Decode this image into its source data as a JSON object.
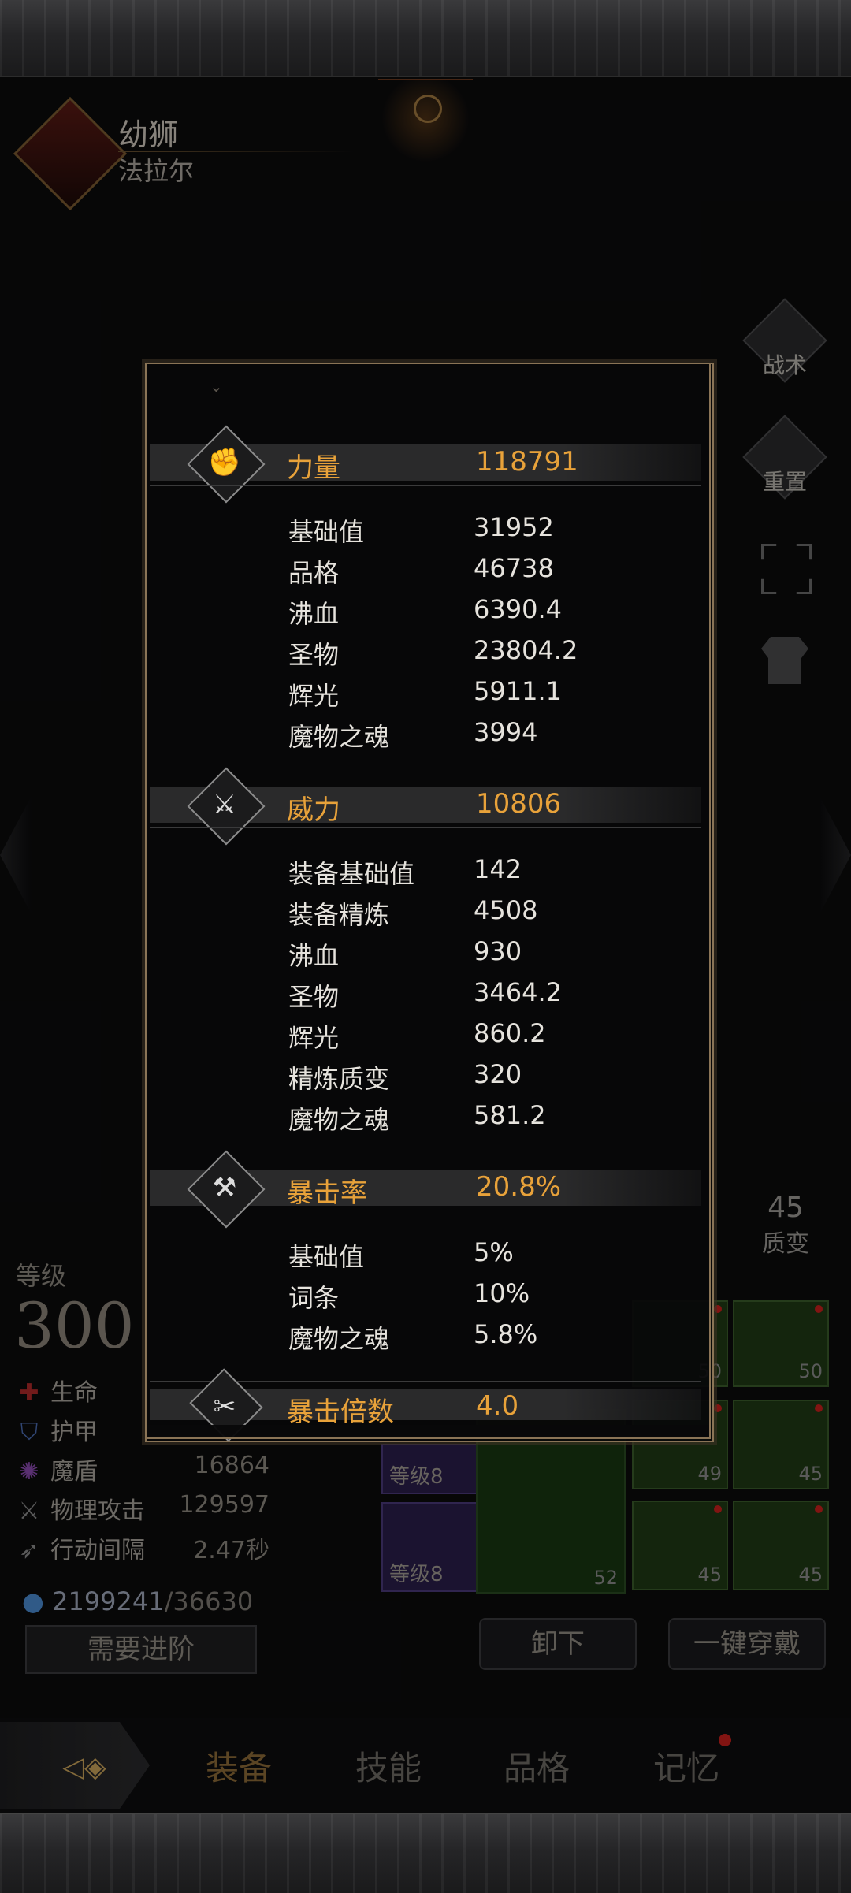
{
  "hero": {
    "name": "幼狮",
    "class": "法拉尔"
  },
  "side_buttons": {
    "tactics": "战术",
    "reset": "重置"
  },
  "left_stats": {
    "level_label": "等级",
    "level_value": "300",
    "rows": [
      {
        "icon": "heart-icon",
        "label": "生命",
        "value": ""
      },
      {
        "icon": "shield-icon",
        "label": "护甲",
        "value": ""
      },
      {
        "icon": "magic-shield-icon",
        "label": "魔盾",
        "value": "16864"
      },
      {
        "icon": "sword-icon",
        "label": "物理攻击",
        "value": "129597"
      },
      {
        "icon": "speed-icon",
        "label": "行动间隔",
        "value": "2.47秒"
      }
    ],
    "gold_current": "2199241",
    "gold_required": "/36630",
    "advance_label": "需要进阶"
  },
  "equipment": {
    "slot_levels": [
      "等级8",
      "等级8"
    ],
    "slot_numbers": [
      "50",
      "49",
      "45",
      "52",
      "45",
      "45",
      "50"
    ],
    "unequip_label": "卸下",
    "equip_all_label": "一键穿戴",
    "quality_badge_value": "45",
    "quality_badge_label": "质变"
  },
  "nav": {
    "items": [
      "装备",
      "技能",
      "品格",
      "记忆"
    ],
    "active": "装备"
  },
  "panel": {
    "sections": [
      {
        "title": "力量",
        "value": "118791",
        "rows": [
          {
            "label": "基础值",
            "value": "31952"
          },
          {
            "label": "品格",
            "value": "46738"
          },
          {
            "label": "沸血",
            "value": "6390.4"
          },
          {
            "label": "圣物",
            "value": "23804.2"
          },
          {
            "label": "辉光",
            "value": "5911.1"
          },
          {
            "label": "魔物之魂",
            "value": "3994"
          }
        ]
      },
      {
        "title": "威力",
        "value": "10806",
        "rows": [
          {
            "label": "装备基础值",
            "value": "142"
          },
          {
            "label": "装备精炼",
            "value": "4508"
          },
          {
            "label": "沸血",
            "value": "930"
          },
          {
            "label": "圣物",
            "value": "3464.2"
          },
          {
            "label": "辉光",
            "value": "860.2"
          },
          {
            "label": "精炼质变",
            "value": "320"
          },
          {
            "label": "魔物之魂",
            "value": "581.2"
          }
        ]
      },
      {
        "title": "暴击率",
        "value": "20.8%",
        "rows": [
          {
            "label": "基础值",
            "value": "5%"
          },
          {
            "label": "词条",
            "value": "10%"
          },
          {
            "label": "魔物之魂",
            "value": "5.8%"
          }
        ]
      },
      {
        "title": "暴击倍数",
        "value": "4.0",
        "rows": []
      }
    ]
  },
  "colors": {
    "accent": "#e8a23a",
    "panel_border": "#8a7456",
    "badge_red": "#c8201c"
  }
}
